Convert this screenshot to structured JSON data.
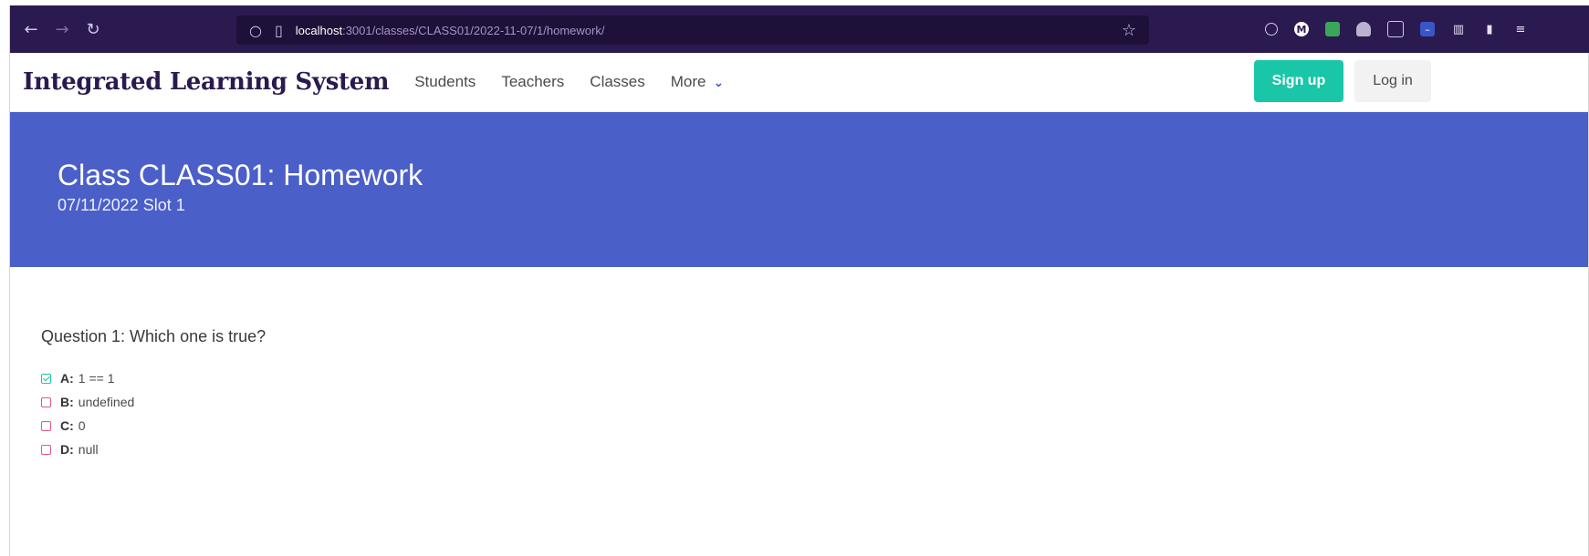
{
  "browser": {
    "url_host": "localhost",
    "url_rest": ":3001/classes/CLASS01/2022-11-07/1/homework/"
  },
  "navbar": {
    "brand": "Integrated Learning System",
    "links": [
      "Students",
      "Teachers",
      "Classes",
      "More"
    ],
    "signup_label": "Sign up",
    "login_label": "Log in",
    "accent": "#19c6a7"
  },
  "hero": {
    "title": "Class CLASS01: Homework",
    "subtitle": "07/11/2022 Slot 1",
    "color": "#4a5fc8"
  },
  "question": {
    "text": "Question 1: Which one is true?",
    "options": [
      {
        "key": "A:",
        "value": "1 == 1",
        "checked": true
      },
      {
        "key": "B:",
        "value": "undefined",
        "checked": false
      },
      {
        "key": "C:",
        "value": "0",
        "checked": false
      },
      {
        "key": "D:",
        "value": "null",
        "checked": false
      }
    ]
  }
}
